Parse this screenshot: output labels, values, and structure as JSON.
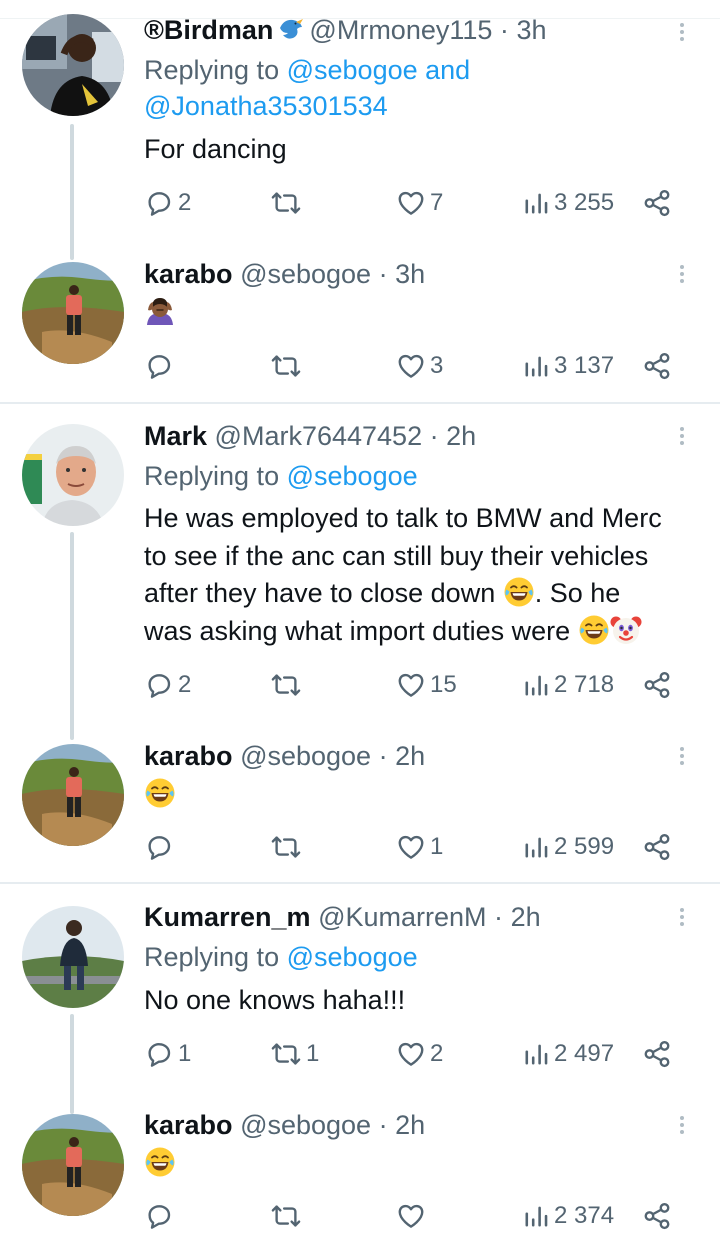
{
  "tweets": [
    {
      "name": "®Birdman",
      "handle": "@Mrmoney115",
      "time": "3h",
      "replying_label": "Replying to",
      "mentions": [
        "@sebogoe",
        "and",
        "@Jonatha35301534"
      ],
      "text": "For dancing",
      "replies": "2",
      "retweets": "",
      "likes": "7",
      "views": "3 255"
    },
    {
      "name": "karabo",
      "handle": "@sebogoe",
      "time": "3h",
      "emoji": "person-facepalming-emoji",
      "replies": "",
      "retweets": "",
      "likes": "3",
      "views": "3 137"
    },
    {
      "name": "Mark",
      "handle": "@Mark76447452",
      "time": "2h",
      "replying_label": "Replying to",
      "mention": "@sebogoe",
      "lines": [
        "He was employed to talk to BMW and Merc",
        "to see if the anc can still buy their vehicles",
        "after they have to close down",
        ". So he",
        "was asking what import duties were"
      ],
      "replies": "2",
      "retweets": "",
      "likes": "15",
      "views": "2 718"
    },
    {
      "name": "karabo",
      "handle": "@sebogoe",
      "time": "2h",
      "emoji": "face-with-tears-of-joy-emoji",
      "replies": "",
      "retweets": "",
      "likes": "1",
      "views": "2 599"
    },
    {
      "name": "Kumarren_m",
      "handle": "@KumarrenM",
      "time": "2h",
      "replying_label": "Replying to",
      "mention": "@sebogoe",
      "text": "No one knows haha!!!",
      "replies": "1",
      "retweets": "1",
      "likes": "2",
      "views": "2 497"
    },
    {
      "name": "karabo",
      "handle": "@sebogoe",
      "time": "2h",
      "emoji": "face-with-tears-of-joy-emoji",
      "replies": "",
      "retweets": "",
      "likes": "",
      "views": "2 374"
    }
  ],
  "separator": "·",
  "colors": {
    "text": "#0f1419",
    "secondary": "#536471",
    "link": "#1d9bf0",
    "thread_line": "#cfd9de",
    "divider": "#e6ecf0"
  }
}
